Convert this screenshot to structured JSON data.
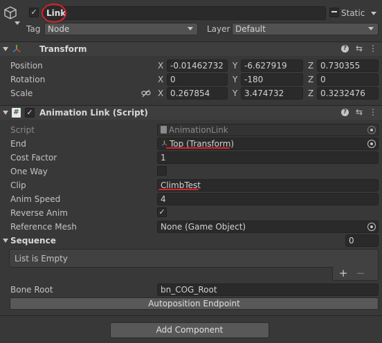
{
  "gameobject": {
    "name": "Link",
    "static_label": "Static",
    "tag_label": "Tag",
    "tag_value": "Node",
    "layer_label": "Layer",
    "layer_value": "Default"
  },
  "transform": {
    "title": "Transform",
    "rows": [
      {
        "label": "Position",
        "x": "-0.01462732",
        "y": "-6.627919",
        "z": "0.730355"
      },
      {
        "label": "Rotation",
        "x": "0",
        "y": "-180",
        "z": "0"
      },
      {
        "label": "Scale",
        "x": "0.267854",
        "y": "3.474732",
        "z": "0.3232476"
      }
    ],
    "axis_x": "X",
    "axis_y": "Y",
    "axis_z": "Z"
  },
  "animation_link": {
    "title": "Animation Link (Script)",
    "script_label": "Script",
    "script_value": "AnimationLink",
    "end_label": "End",
    "end_value": "Top (Transform)",
    "cost_factor_label": "Cost Factor",
    "cost_factor_value": "1",
    "one_way_label": "One Way",
    "clip_label": "Clip",
    "clip_value": "ClimbTest",
    "anim_speed_label": "Anim Speed",
    "anim_speed_value": "4",
    "reverse_anim_label": "Reverse Anim",
    "reference_mesh_label": "Reference Mesh",
    "reference_mesh_value": "None (Game Object)",
    "sequence_label": "Sequence",
    "sequence_count": "0",
    "list_empty": "List is Empty",
    "bone_root_label": "Bone Root",
    "bone_root_value": "bn_COG_Root",
    "autoposition_label": "Autoposition Endpoint"
  },
  "add_component_label": "Add Component",
  "colors": {
    "background": "#383838",
    "field": "#2a2a2a",
    "annotation_red": "#e0202a"
  }
}
